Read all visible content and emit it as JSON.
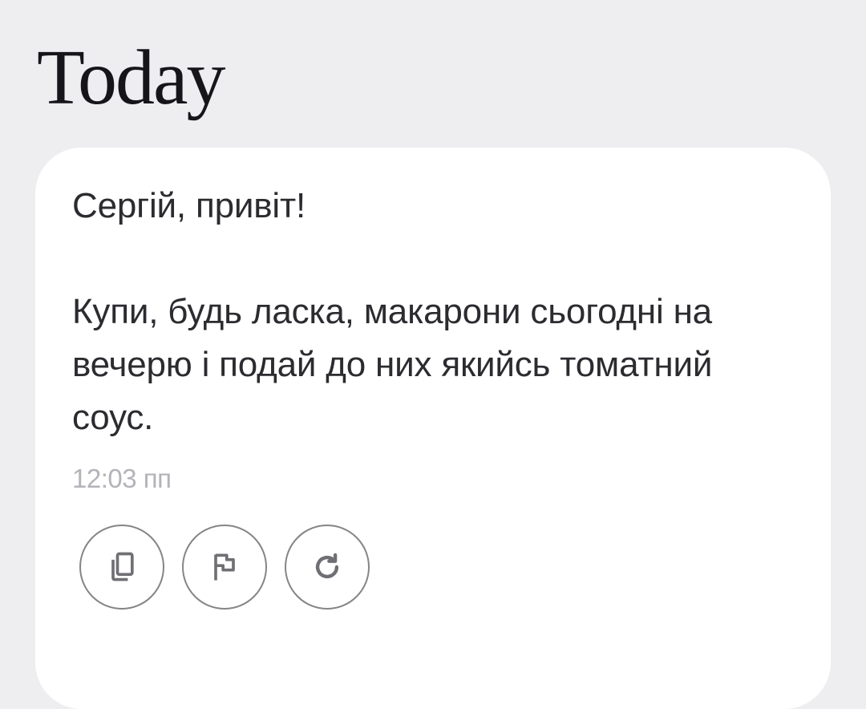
{
  "header": {
    "title": "Today"
  },
  "message": {
    "greeting": "Сергій, привіт!",
    "body": "Купи, будь ласка, макарони сьогодні на вечерю і подай до них якийсь томатний соус.",
    "timestamp": "12:03 пп"
  },
  "actions": [
    {
      "icon": "copy-icon"
    },
    {
      "icon": "flag-icon"
    },
    {
      "icon": "refresh-icon"
    }
  ],
  "colors": {
    "background": "#eeeef1",
    "card": "#ffffff",
    "text": "#2b2b30",
    "muted": "#b3b3ba",
    "icon": "#6f6f74"
  }
}
